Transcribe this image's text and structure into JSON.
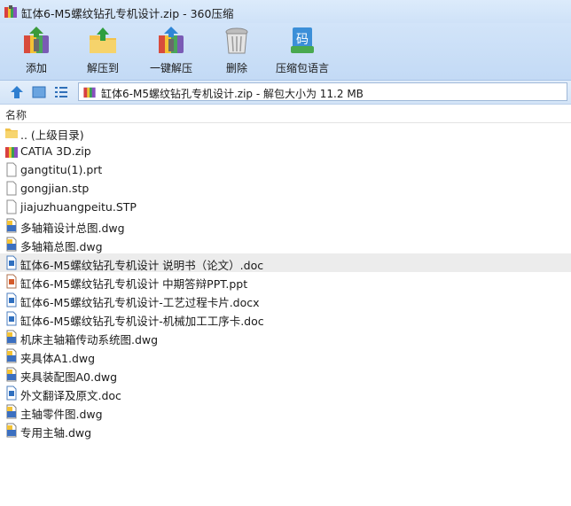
{
  "window": {
    "title": "缸体6-M5螺纹钻孔专机设计.zip - 360压缩"
  },
  "toolbar": {
    "buttons": [
      {
        "label": "添加"
      },
      {
        "label": "解压到"
      },
      {
        "label": "一键解压"
      },
      {
        "label": "删除"
      },
      {
        "label": "压缩包语言"
      }
    ],
    "lang_glyph": "码"
  },
  "address": {
    "text": "缸体6-M5螺纹钻孔专机设计.zip - 解包大小为 11.2 MB"
  },
  "list": {
    "column_name": "名称",
    "items": [
      {
        "name": ".. (上级目录)",
        "icon": "folder-icon"
      },
      {
        "name": "CATIA 3D.zip",
        "icon": "zip-archive-icon"
      },
      {
        "name": "gangtitu(1).prt",
        "icon": "blank-file-icon"
      },
      {
        "name": "gongjian.stp",
        "icon": "blank-file-icon"
      },
      {
        "name": "jiajuzhuangpeitu.STP",
        "icon": "blank-file-icon"
      },
      {
        "name": "多轴箱设计总图.dwg",
        "icon": "dwg-file-icon"
      },
      {
        "name": "多轴箱总图.dwg",
        "icon": "dwg-file-icon"
      },
      {
        "name": "缸体6-M5螺纹钻孔专机设计 说明书（论文）.doc",
        "icon": "word-doc-icon"
      },
      {
        "name": "缸体6-M5螺纹钻孔专机设计 中期答辩PPT.ppt",
        "icon": "ppt-file-icon"
      },
      {
        "name": "缸体6-M5螺纹钻孔专机设计-工艺过程卡片.docx",
        "icon": "word-doc-icon"
      },
      {
        "name": "缸体6-M5螺纹钻孔专机设计-机械加工工序卡.doc",
        "icon": "word-doc-icon"
      },
      {
        "name": "机床主轴箱传动系统图.dwg",
        "icon": "dwg-file-icon"
      },
      {
        "name": "夹具体A1.dwg",
        "icon": "dwg-file-icon"
      },
      {
        "name": "夹具装配图A0.dwg",
        "icon": "dwg-file-icon"
      },
      {
        "name": "外文翻译及原文.doc",
        "icon": "word-doc-icon"
      },
      {
        "name": "主轴零件图.dwg",
        "icon": "dwg-file-icon"
      },
      {
        "name": "专用主轴.dwg",
        "icon": "dwg-file-icon"
      }
    ]
  }
}
